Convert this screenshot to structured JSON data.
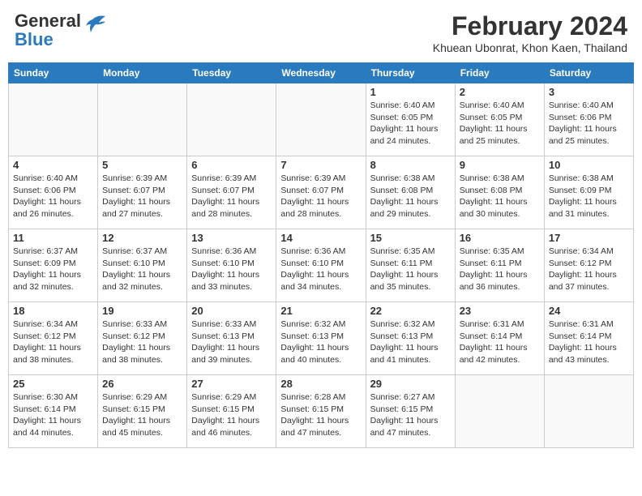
{
  "header": {
    "logo_line1": "General",
    "logo_line2": "Blue",
    "month_year": "February 2024",
    "location": "Khuean Ubonrat, Khon Kaen, Thailand"
  },
  "weekdays": [
    "Sunday",
    "Monday",
    "Tuesday",
    "Wednesday",
    "Thursday",
    "Friday",
    "Saturday"
  ],
  "weeks": [
    [
      {
        "day": "",
        "info": ""
      },
      {
        "day": "",
        "info": ""
      },
      {
        "day": "",
        "info": ""
      },
      {
        "day": "",
        "info": ""
      },
      {
        "day": "1",
        "info": "Sunrise: 6:40 AM\nSunset: 6:05 PM\nDaylight: 11 hours and 24 minutes."
      },
      {
        "day": "2",
        "info": "Sunrise: 6:40 AM\nSunset: 6:05 PM\nDaylight: 11 hours and 25 minutes."
      },
      {
        "day": "3",
        "info": "Sunrise: 6:40 AM\nSunset: 6:06 PM\nDaylight: 11 hours and 25 minutes."
      }
    ],
    [
      {
        "day": "4",
        "info": "Sunrise: 6:40 AM\nSunset: 6:06 PM\nDaylight: 11 hours and 26 minutes."
      },
      {
        "day": "5",
        "info": "Sunrise: 6:39 AM\nSunset: 6:07 PM\nDaylight: 11 hours and 27 minutes."
      },
      {
        "day": "6",
        "info": "Sunrise: 6:39 AM\nSunset: 6:07 PM\nDaylight: 11 hours and 28 minutes."
      },
      {
        "day": "7",
        "info": "Sunrise: 6:39 AM\nSunset: 6:07 PM\nDaylight: 11 hours and 28 minutes."
      },
      {
        "day": "8",
        "info": "Sunrise: 6:38 AM\nSunset: 6:08 PM\nDaylight: 11 hours and 29 minutes."
      },
      {
        "day": "9",
        "info": "Sunrise: 6:38 AM\nSunset: 6:08 PM\nDaylight: 11 hours and 30 minutes."
      },
      {
        "day": "10",
        "info": "Sunrise: 6:38 AM\nSunset: 6:09 PM\nDaylight: 11 hours and 31 minutes."
      }
    ],
    [
      {
        "day": "11",
        "info": "Sunrise: 6:37 AM\nSunset: 6:09 PM\nDaylight: 11 hours and 32 minutes."
      },
      {
        "day": "12",
        "info": "Sunrise: 6:37 AM\nSunset: 6:10 PM\nDaylight: 11 hours and 32 minutes."
      },
      {
        "day": "13",
        "info": "Sunrise: 6:36 AM\nSunset: 6:10 PM\nDaylight: 11 hours and 33 minutes."
      },
      {
        "day": "14",
        "info": "Sunrise: 6:36 AM\nSunset: 6:10 PM\nDaylight: 11 hours and 34 minutes."
      },
      {
        "day": "15",
        "info": "Sunrise: 6:35 AM\nSunset: 6:11 PM\nDaylight: 11 hours and 35 minutes."
      },
      {
        "day": "16",
        "info": "Sunrise: 6:35 AM\nSunset: 6:11 PM\nDaylight: 11 hours and 36 minutes."
      },
      {
        "day": "17",
        "info": "Sunrise: 6:34 AM\nSunset: 6:12 PM\nDaylight: 11 hours and 37 minutes."
      }
    ],
    [
      {
        "day": "18",
        "info": "Sunrise: 6:34 AM\nSunset: 6:12 PM\nDaylight: 11 hours and 38 minutes."
      },
      {
        "day": "19",
        "info": "Sunrise: 6:33 AM\nSunset: 6:12 PM\nDaylight: 11 hours and 38 minutes."
      },
      {
        "day": "20",
        "info": "Sunrise: 6:33 AM\nSunset: 6:13 PM\nDaylight: 11 hours and 39 minutes."
      },
      {
        "day": "21",
        "info": "Sunrise: 6:32 AM\nSunset: 6:13 PM\nDaylight: 11 hours and 40 minutes."
      },
      {
        "day": "22",
        "info": "Sunrise: 6:32 AM\nSunset: 6:13 PM\nDaylight: 11 hours and 41 minutes."
      },
      {
        "day": "23",
        "info": "Sunrise: 6:31 AM\nSunset: 6:14 PM\nDaylight: 11 hours and 42 minutes."
      },
      {
        "day": "24",
        "info": "Sunrise: 6:31 AM\nSunset: 6:14 PM\nDaylight: 11 hours and 43 minutes."
      }
    ],
    [
      {
        "day": "25",
        "info": "Sunrise: 6:30 AM\nSunset: 6:14 PM\nDaylight: 11 hours and 44 minutes."
      },
      {
        "day": "26",
        "info": "Sunrise: 6:29 AM\nSunset: 6:15 PM\nDaylight: 11 hours and 45 minutes."
      },
      {
        "day": "27",
        "info": "Sunrise: 6:29 AM\nSunset: 6:15 PM\nDaylight: 11 hours and 46 minutes."
      },
      {
        "day": "28",
        "info": "Sunrise: 6:28 AM\nSunset: 6:15 PM\nDaylight: 11 hours and 47 minutes."
      },
      {
        "day": "29",
        "info": "Sunrise: 6:27 AM\nSunset: 6:15 PM\nDaylight: 11 hours and 47 minutes."
      },
      {
        "day": "",
        "info": ""
      },
      {
        "day": "",
        "info": ""
      }
    ]
  ]
}
